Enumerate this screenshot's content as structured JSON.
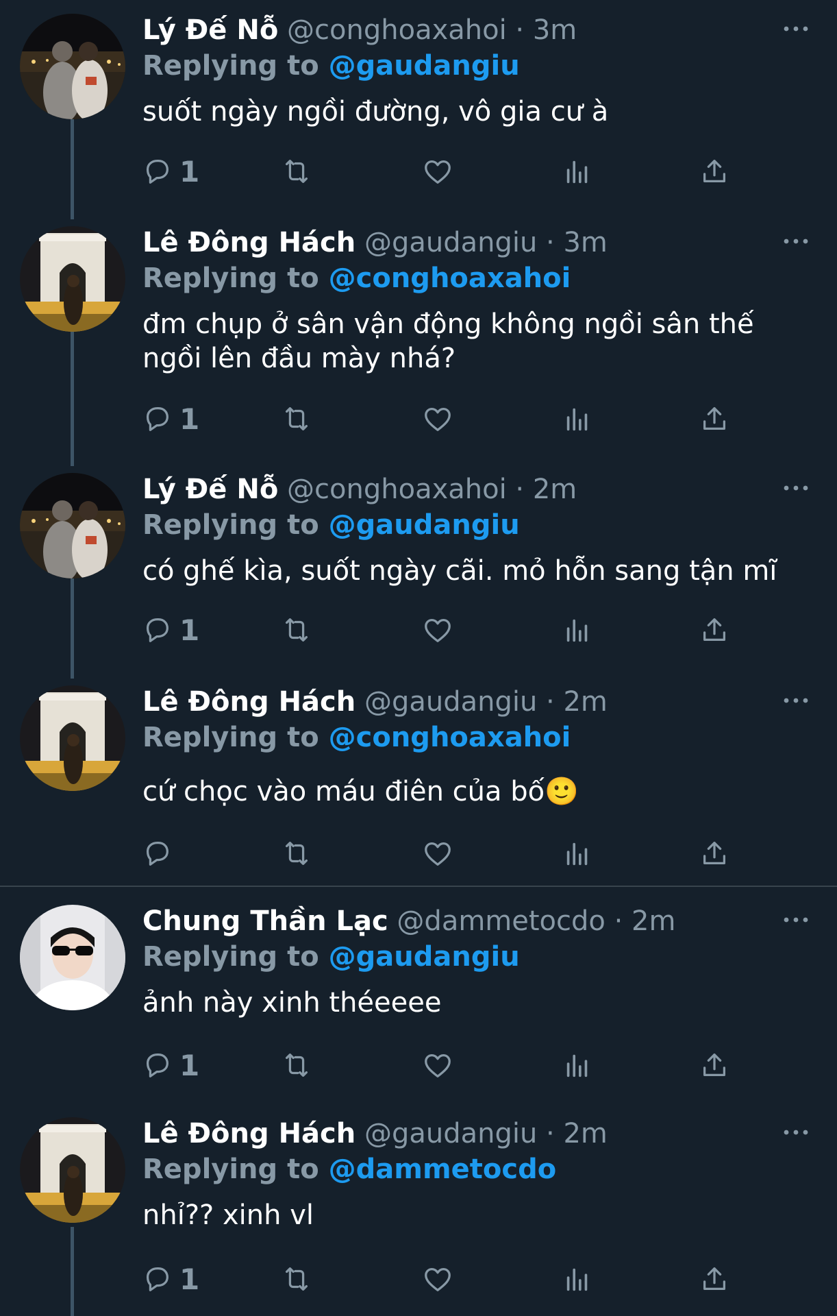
{
  "tweets": [
    {
      "name": "Lý Đế Nỗ",
      "handle": "@conghoaxahoi",
      "time": "· 3m",
      "reply_prefix": "Replying to",
      "reply_to": "@gaudangiu",
      "text": "suốt ngày ngồi đường, vô gia cư à",
      "reply_count": "1",
      "avatar": "couple-night-avatar"
    },
    {
      "name": "Lê Đông Hách",
      "handle": "@gaudangiu",
      "time": "· 3m",
      "reply_prefix": "Replying to",
      "reply_to": "@conghoaxahoi",
      "text": "đm chụp ở sân vận động không ngồi sân thế ngồi lên đầu mày nhá?",
      "reply_count": "1",
      "avatar": "arc-triomphe-avatar"
    },
    {
      "name": "Lý Đế Nỗ",
      "handle": "@conghoaxahoi",
      "time": "· 2m",
      "reply_prefix": "Replying to",
      "reply_to": "@gaudangiu",
      "text": "có ghế kìa, suốt ngày cãi. mỏ hỗn sang tận mĩ",
      "reply_count": "1",
      "avatar": "couple-night-avatar"
    },
    {
      "name": "Lê Đông Hách",
      "handle": "@gaudangiu",
      "time": "· 2m",
      "reply_prefix": "Replying to",
      "reply_to": "@conghoaxahoi",
      "text": "cứ chọc vào máu điên của bố🙂",
      "reply_count": "",
      "avatar": "arc-triomphe-avatar"
    },
    {
      "name": "Chung Thần Lạc",
      "handle": "@dammetocdo",
      "time": "· 2m",
      "reply_prefix": "Replying to",
      "reply_to": "@gaudangiu",
      "text": "ảnh này xinh théeeee",
      "reply_count": "1",
      "avatar": "sunglasses-boy-avatar"
    },
    {
      "name": "Lê Đông Hách",
      "handle": "@gaudangiu",
      "time": "· 2m",
      "reply_prefix": "Replying to",
      "reply_to": "@dammetocdo",
      "text": "nhỉ?? xinh vl",
      "reply_count": "1",
      "avatar": "arc-triomphe-avatar"
    }
  ],
  "colors": {
    "background": "#15202b",
    "text_primary": "#ffffff",
    "text_secondary": "#8899a6",
    "accent": "#1d9bf0",
    "thread_line": "#3d5466",
    "divider": "#38444d"
  },
  "icons": {
    "reply": "reply-icon",
    "retweet": "retweet-icon",
    "like": "heart-icon",
    "analytics": "analytics-icon",
    "share": "share-icon",
    "more": "more-options-icon"
  }
}
